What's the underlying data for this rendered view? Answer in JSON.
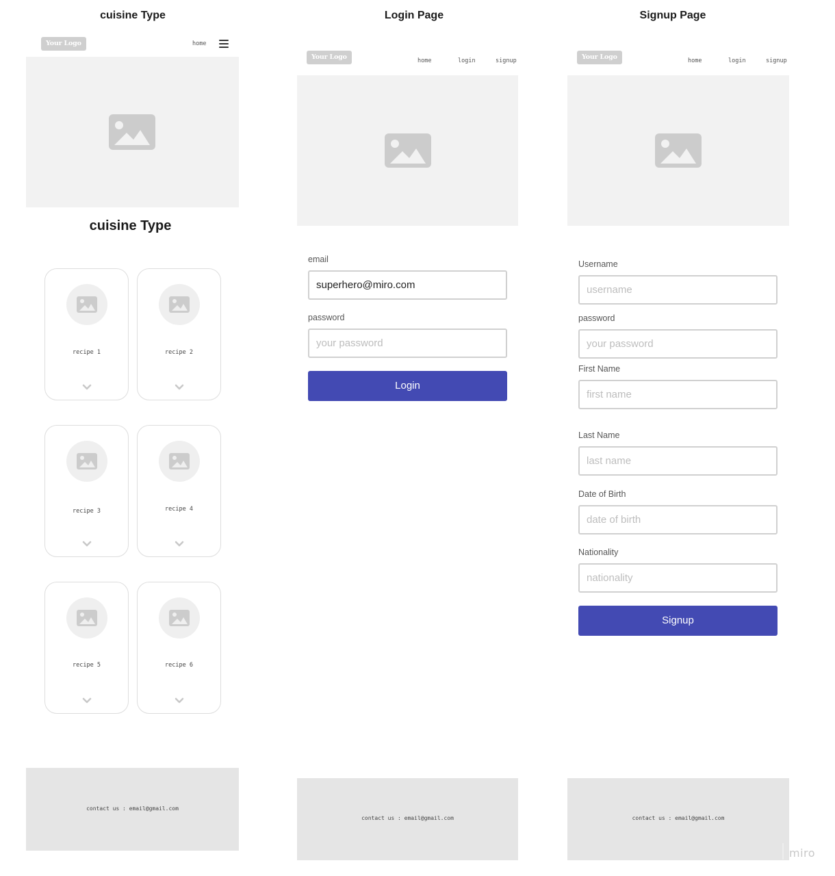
{
  "frames": [
    {
      "title": "cuisine Type",
      "logo": "Your Logo",
      "nav": [
        "home"
      ],
      "menu_icon": "hamburger-menu-icon",
      "section_title": "cuisine Type",
      "cards": [
        {
          "label": "recipe 1"
        },
        {
          "label": "recipe 2"
        },
        {
          "label": "recipe 3"
        },
        {
          "label": "recipe 4"
        },
        {
          "label": "recipe 5"
        },
        {
          "label": "recipe 6"
        }
      ],
      "footer": "contact us : email@gmail.com"
    },
    {
      "title": "Login Page",
      "logo": "Your Logo",
      "nav": [
        "home",
        "login",
        "signup"
      ],
      "fields": [
        {
          "label": "email",
          "value": "superhero@miro.com",
          "placeholder": ""
        },
        {
          "label": "password",
          "value": "",
          "placeholder": "your password"
        }
      ],
      "button": "Login",
      "footer": "contact us : email@gmail.com"
    },
    {
      "title": "Signup Page",
      "logo": "Your Logo",
      "nav": [
        "home",
        "login",
        "signup"
      ],
      "fields": [
        {
          "label": "Username",
          "placeholder": "username"
        },
        {
          "label": "password",
          "placeholder": "your password"
        },
        {
          "label": "First Name",
          "placeholder": "first name"
        },
        {
          "label": "Last Name",
          "placeholder": "last name"
        },
        {
          "label": "Date of Birth",
          "placeholder": "date of birth"
        },
        {
          "label": "Nationality",
          "placeholder": "nationality"
        }
      ],
      "button": "Signup",
      "footer": "contact us : email@gmail.com"
    }
  ],
  "watermark": "miro",
  "colors": {
    "primary_button": "#434ab3",
    "placeholder_bg": "#f2f2f2",
    "footer_bg": "#e5e5e5",
    "logo_bg": "#cfcfcf",
    "icon_gray": "#cccccc"
  }
}
